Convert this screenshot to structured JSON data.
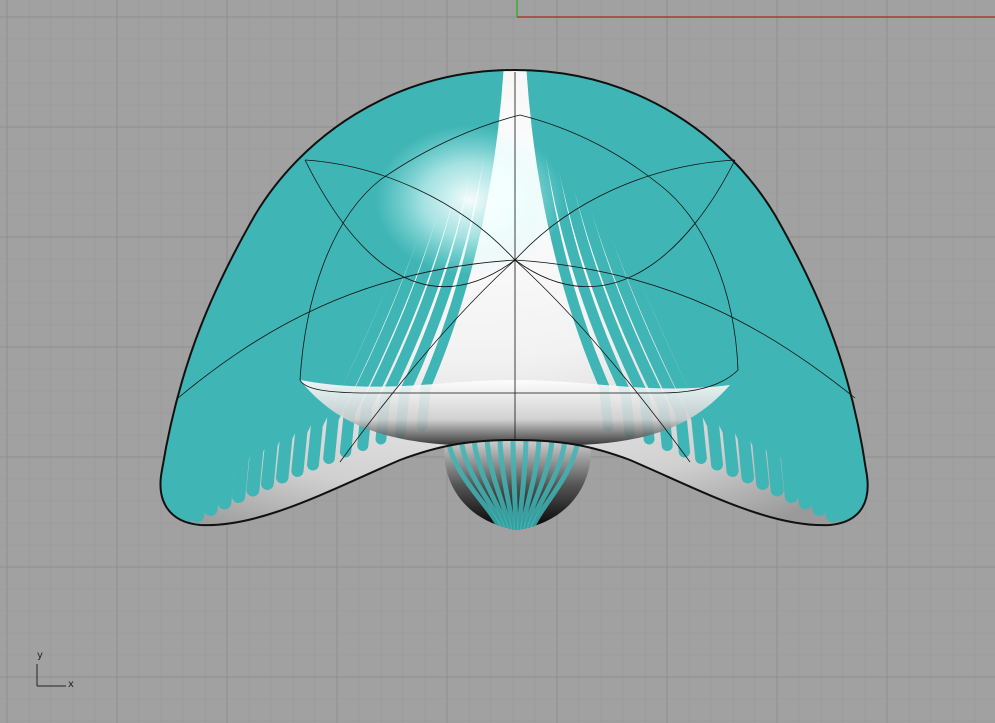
{
  "viewport": {
    "background_color": "#a1a1a1",
    "grid_minor_color": "#999999",
    "grid_major_color": "#8e8e8e",
    "world_x_axis_color": "#b22222",
    "world_y_axis_color": "#22aa22",
    "icons": [
      "axis-triad-icon"
    ]
  },
  "axes": {
    "y_label": "y",
    "x_label": "x"
  },
  "model": {
    "stripe_color": "#3fb5b5",
    "highlight_color": "#ffffff",
    "edge_color": "#111111"
  }
}
